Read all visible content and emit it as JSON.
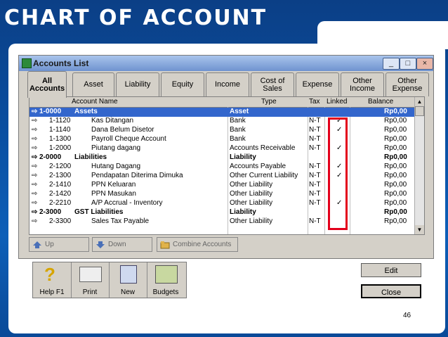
{
  "slide": {
    "title": "CHART OF ACCOUNT",
    "page_number": "46"
  },
  "window": {
    "title": "Accounts List",
    "controls": [
      "_",
      "□",
      "×"
    ]
  },
  "tabs": [
    {
      "label": "All Accounts",
      "active": true
    },
    {
      "label": "Asset"
    },
    {
      "label": "Liability"
    },
    {
      "label": "Equity"
    },
    {
      "label": "Income"
    },
    {
      "label": "Cost of Sales"
    },
    {
      "label": "Expense"
    },
    {
      "label": "Other Income"
    },
    {
      "label": "Other Expense"
    }
  ],
  "columns": [
    "Account Name",
    "Type",
    "Tax",
    "Linked",
    "Balance"
  ],
  "rows": [
    {
      "num": "1-0000",
      "name": "Assets",
      "type": "Asset",
      "tax": "",
      "linked": "",
      "balance": "Rp0,00",
      "selected": true,
      "header": true
    },
    {
      "num": "1-1120",
      "name": "Kas Ditangan",
      "type": "Bank",
      "tax": "N-T",
      "linked": "✓",
      "balance": "Rp0,00"
    },
    {
      "num": "1-1140",
      "name": "Dana Belum Disetor",
      "type": "Bank",
      "tax": "N-T",
      "linked": "✓",
      "balance": "Rp0,00"
    },
    {
      "num": "1-1300",
      "name": "Payroll Cheque Account",
      "type": "Bank",
      "tax": "N-T",
      "linked": "",
      "balance": "Rp0,00"
    },
    {
      "num": "1-2000",
      "name": "Piutang dagang",
      "type": "Accounts Receivable",
      "tax": "N-T",
      "linked": "✓",
      "balance": "Rp0,00"
    },
    {
      "num": "2-0000",
      "name": "Liabilities",
      "type": "Liability",
      "tax": "",
      "linked": "",
      "balance": "Rp0,00",
      "header": true
    },
    {
      "num": "2-1200",
      "name": "Hutang Dagang",
      "type": "Accounts Payable",
      "tax": "N-T",
      "linked": "✓",
      "balance": "Rp0,00"
    },
    {
      "num": "2-1300",
      "name": "Pendapatan Diterima Dimuka",
      "type": "Other Current Liability",
      "tax": "N-T",
      "linked": "✓",
      "balance": "Rp0,00"
    },
    {
      "num": "2-1410",
      "name": "PPN Keluaran",
      "type": "Other Liability",
      "tax": "N-T",
      "linked": "",
      "balance": "Rp0,00"
    },
    {
      "num": "2-1420",
      "name": "PPN Masukan",
      "type": "Other Liability",
      "tax": "N-T",
      "linked": "",
      "balance": "Rp0,00"
    },
    {
      "num": "2-2210",
      "name": "A/P Accrual - Inventory",
      "type": "Other Liability",
      "tax": "N-T",
      "linked": "✓",
      "balance": "Rp0,00"
    },
    {
      "num": "2-3000",
      "name": "GST Liabilities",
      "type": "Liability",
      "tax": "",
      "linked": "",
      "balance": "Rp0,00",
      "header": true
    },
    {
      "num": "2-3300",
      "name": "Sales Tax Payable",
      "type": "Other Liability",
      "tax": "N-T",
      "linked": "",
      "balance": "Rp0,00"
    }
  ],
  "actions": {
    "up": "Up",
    "down": "Down",
    "combine": "Combine Accounts"
  },
  "toolbar": {
    "help": "Help F1",
    "print": "Print",
    "new": "New",
    "budgets": "Budgets"
  },
  "buttons": {
    "edit": "Edit",
    "close": "Close"
  },
  "colors": {
    "highlight": "#3366cc",
    "linked_box": "#e3001b"
  }
}
